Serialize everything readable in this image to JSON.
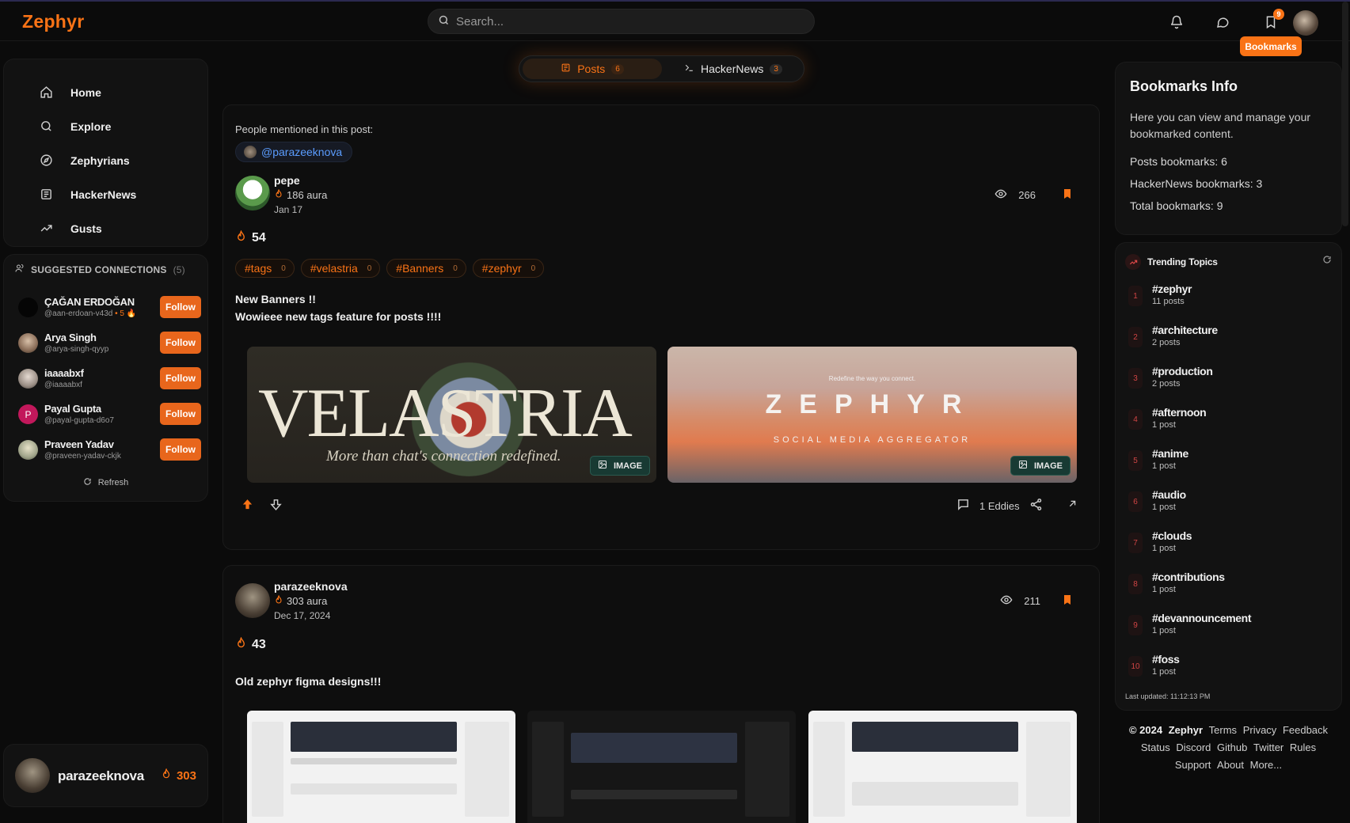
{
  "app": {
    "name": "Zephyr"
  },
  "search": {
    "placeholder": "Search..."
  },
  "header": {
    "notifications_badge": "9",
    "tooltip": "Bookmarks"
  },
  "nav": {
    "items": [
      {
        "label": "Home",
        "icon": "home-icon"
      },
      {
        "label": "Explore",
        "icon": "search-icon"
      },
      {
        "label": "Zephyrians",
        "icon": "compass-icon"
      },
      {
        "label": "HackerNews",
        "icon": "newspaper-icon"
      },
      {
        "label": "Gusts",
        "icon": "trending-icon"
      }
    ]
  },
  "suggestions": {
    "title": "SUGGESTED CONNECTIONS",
    "count": "(5)",
    "follow_label": "Follow",
    "refresh_label": "Refresh",
    "people": [
      {
        "name": "ÇAĞAN ERDOĞAN",
        "handle": "@aan-erdoan-v43d",
        "aura": "• 5",
        "avatar_color": "#050505"
      },
      {
        "name": "Arya Singh",
        "handle": "@arya-singh-qyyp",
        "aura": "",
        "avatar_color": "#8a6d58"
      },
      {
        "name": "iaaaabxf",
        "handle": "@iaaaabxf",
        "aura": "",
        "avatar_color": "#9b8f86"
      },
      {
        "name": "Payal Gupta",
        "handle": "@payal-gupta-d6o7",
        "aura": "",
        "avatar_color": "#c2185b",
        "initial": "P"
      },
      {
        "name": "Praveen Yadav",
        "handle": "@praveen-yadav-ckjk",
        "aura": "",
        "avatar_color": "#a0a48a"
      }
    ]
  },
  "current_user": {
    "name": "parazeeknova",
    "aura": "303"
  },
  "tabs": [
    {
      "label": "Posts",
      "count": "6"
    },
    {
      "label": "HackerNews",
      "count": "3"
    }
  ],
  "posts": [
    {
      "mentions_label": "People mentioned in this post:",
      "mention": "@parazeeknova",
      "author": "pepe",
      "aura": "186 aura",
      "date": "Jan 17",
      "views": "266",
      "score": "54",
      "tags": [
        {
          "name": "#tags",
          "count": "0"
        },
        {
          "name": "#velastria",
          "count": "0"
        },
        {
          "name": "#Banners",
          "count": "0"
        },
        {
          "name": "#zephyr",
          "count": "0"
        }
      ],
      "text_lines": [
        "New Banners !!",
        "Wowieee new tags feature for posts !!!!"
      ],
      "images": [
        {
          "badge": "IMAGE",
          "title": "VELASTRIA",
          "subtitle": "More than chat's connection redefined."
        },
        {
          "badge": "IMAGE",
          "top": "Redefine the way you connect.",
          "title": "ZEPHYR",
          "subtitle": "SOCIAL MEDIA AGGREGATOR"
        }
      ],
      "comments": "1 Eddies"
    },
    {
      "author": "parazeeknova",
      "aura": "303 aura",
      "date": "Dec 17, 2024",
      "views": "211",
      "score": "43",
      "text": "Old zephyr figma designs!!!"
    }
  ],
  "bookmarks_info": {
    "title": "Bookmarks Info",
    "description": "Here you can view and manage your bookmarked content.",
    "posts": "Posts bookmarks: 6",
    "hackernews": "HackerNews bookmarks: 3",
    "total": "Total bookmarks: 9"
  },
  "trending": {
    "title": "Trending Topics",
    "items": [
      {
        "rank": "1",
        "tag": "#zephyr",
        "posts": "11 posts"
      },
      {
        "rank": "2",
        "tag": "#architecture",
        "posts": "2 posts"
      },
      {
        "rank": "3",
        "tag": "#production",
        "posts": "2 posts"
      },
      {
        "rank": "4",
        "tag": "#afternoon",
        "posts": "1 post"
      },
      {
        "rank": "5",
        "tag": "#anime",
        "posts": "1 post"
      },
      {
        "rank": "6",
        "tag": "#audio",
        "posts": "1 post"
      },
      {
        "rank": "7",
        "tag": "#clouds",
        "posts": "1 post"
      },
      {
        "rank": "8",
        "tag": "#contributions",
        "posts": "1 post"
      },
      {
        "rank": "9",
        "tag": "#devannouncement",
        "posts": "1 post"
      },
      {
        "rank": "10",
        "tag": "#foss",
        "posts": "1 post"
      }
    ],
    "updated": "Last updated: 11:12:13 PM"
  },
  "footer": {
    "copyright": "© 2024",
    "brand": "Zephyr",
    "links": [
      "Terms",
      "Privacy",
      "Feedback",
      "Status",
      "Discord",
      "Github",
      "Twitter",
      "Rules",
      "Support",
      "About",
      "More..."
    ]
  },
  "colors": {
    "accent": "#f97316",
    "background": "#0b0b0b",
    "card": "#121212",
    "mention": "#5b9dff"
  }
}
